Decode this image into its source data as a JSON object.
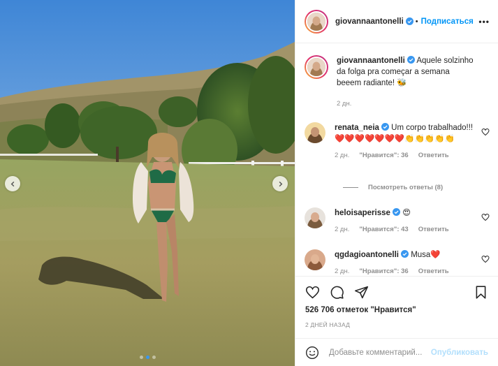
{
  "post": {
    "author": "giovannaantonelli",
    "follow_label": "Подписаться",
    "more_label": "•••",
    "separator": "•",
    "photo_count": 3,
    "photo_active_index": 1,
    "icons": {
      "prev": "chevron-left-icon",
      "next": "chevron-right-icon",
      "like": "heart-outline-icon",
      "comment": "speech-bubble-icon",
      "share": "paper-plane-icon",
      "save": "bookmark-icon",
      "emoji": "smiley-icon",
      "verified": "verified-badge-icon"
    }
  },
  "caption": {
    "username": "giovannaantonelli",
    "text": "Aquele solzinho da folga pra começar a semana beeem radiante! 🐝",
    "time": "2 дн."
  },
  "comments": [
    {
      "username": "renata_neia",
      "text": "Um corpo trabalhado!!!❤️❤️❤️❤️❤️❤️❤️👏👏👏👏👏",
      "time": "2 дн.",
      "likes": "\"Нравится\": 36",
      "reply": "Ответить"
    },
    {
      "username": "heloisaperisse",
      "text": "😍",
      "time": "2 дн.",
      "likes": "\"Нравится\": 43",
      "reply": "Ответить"
    },
    {
      "username": "qgdagioantonelli",
      "text": "Musa❤️",
      "time": "2 дн.",
      "likes": "\"Нравится\": 36",
      "reply": "Ответить"
    }
  ],
  "view_replies": "Посмотреть ответы (8)",
  "likes_text": "526 706 отметок \"Нравится\"",
  "date_text": "2 ДНЕЙ НАЗАД",
  "add_comment": {
    "placeholder": "Добавьте комментарий...",
    "publish": "Опубликовать"
  },
  "colors": {
    "accent": "#0095f6",
    "publish_disabled": "#b2dffc",
    "verified": "#3897f0",
    "muted": "#8e8e8e"
  }
}
